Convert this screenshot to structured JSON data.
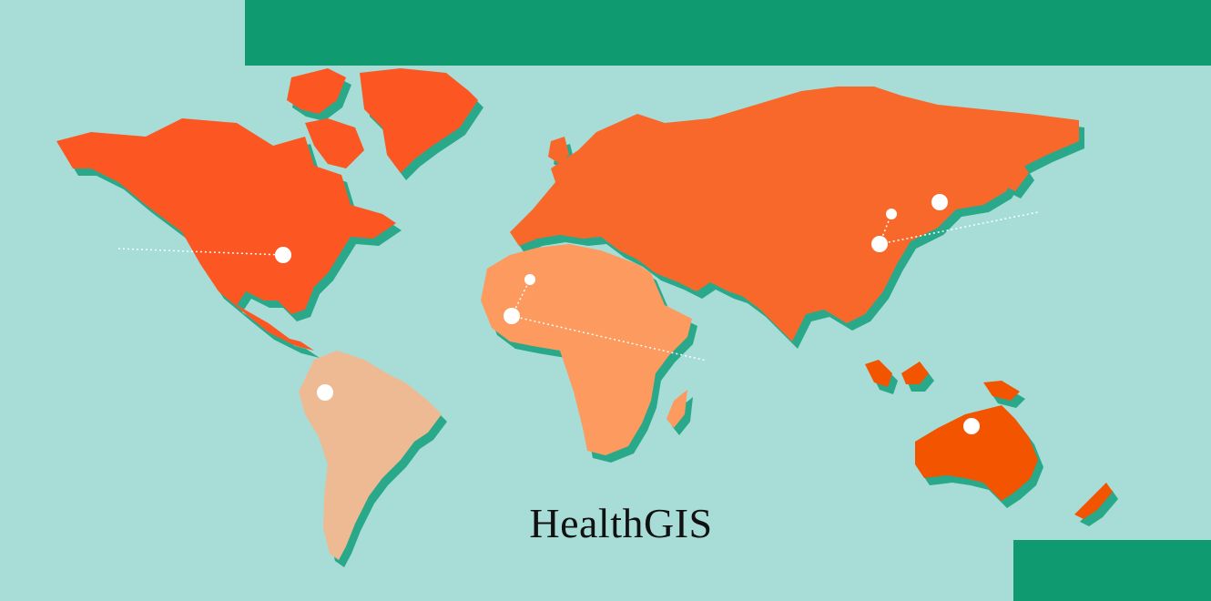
{
  "title": "HealthGIS",
  "colors": {
    "ocean": "#a7ddd6",
    "banner": "#0f9a70",
    "shadow": "#2aa88a",
    "north_america": "#fc5722",
    "south_america": "#eeba94",
    "africa": "#fc9a5f",
    "eurasia": "#f9682b",
    "oceania": "#f25400",
    "text": "#111111"
  },
  "map_markers": [
    {
      "region": "north-america"
    },
    {
      "region": "south-america"
    },
    {
      "region": "west-africa"
    },
    {
      "region": "sahara"
    },
    {
      "region": "east-asia"
    },
    {
      "region": "north-china"
    },
    {
      "region": "korea"
    },
    {
      "region": "australia"
    }
  ]
}
